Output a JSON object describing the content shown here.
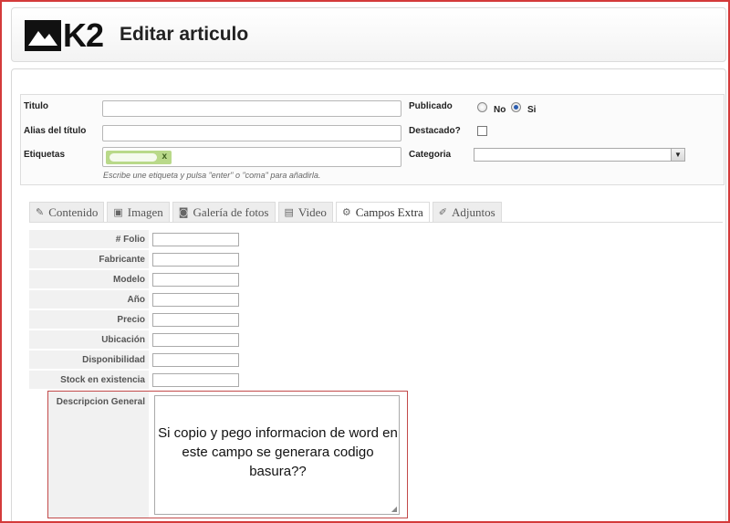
{
  "header": {
    "logo_text": "K2",
    "title": "Editar articulo"
  },
  "form": {
    "titulo_label": "Titulo",
    "alias_label": "Alias del título",
    "etiquetas_label": "Etiquetas",
    "tag_remove": "x",
    "tags_hint": "Escribe une etiqueta y pulsa \"enter\" o \"coma\" para añadirla.",
    "publicado_label": "Publicado",
    "publicado_no": "No",
    "publicado_si": "Si",
    "publicado_value": "Si",
    "destacado_label": "Destacado?",
    "destacado_checked": false,
    "categoria_label": "Categoria",
    "categoria_value": ""
  },
  "tabs": [
    {
      "label": "Contenido",
      "icon": "edit-icon",
      "active": false
    },
    {
      "label": "Imagen",
      "icon": "image-icon",
      "active": false
    },
    {
      "label": "Galería de fotos",
      "icon": "camera-icon",
      "active": false
    },
    {
      "label": "Video",
      "icon": "film-icon",
      "active": false
    },
    {
      "label": "Campos Extra",
      "icon": "wrench-icon",
      "active": true
    },
    {
      "label": "Adjuntos",
      "icon": "paperclip-icon",
      "active": false
    }
  ],
  "extra_fields": [
    {
      "label": "# Folio",
      "value": ""
    },
    {
      "label": "Fabricante",
      "value": ""
    },
    {
      "label": "Modelo",
      "value": ""
    },
    {
      "label": "Año",
      "value": ""
    },
    {
      "label": "Precio",
      "value": ""
    },
    {
      "label": "Ubicación",
      "value": ""
    },
    {
      "label": "Disponibilidad",
      "value": ""
    },
    {
      "label": "Stock en existencia",
      "value": ""
    }
  ],
  "description": {
    "label": "Descripcion General",
    "text": "Si copio y pego informacion de word en este campo se generara codigo basura??"
  },
  "colors": {
    "highlight_border": "#c24a4a",
    "tag_bg": "#b9d98a",
    "frame_border": "#d43a3a"
  }
}
